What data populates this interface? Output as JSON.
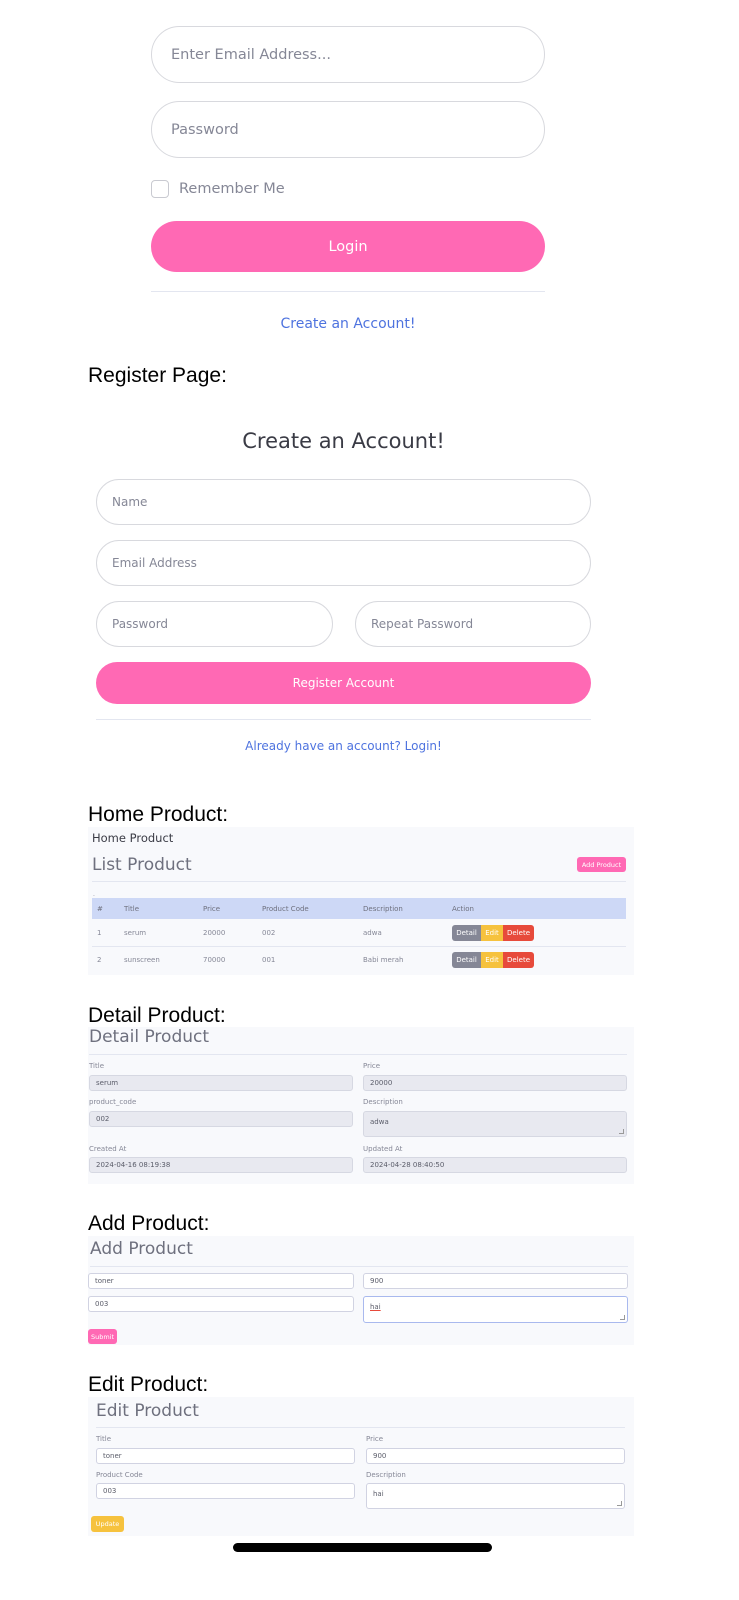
{
  "login": {
    "email_placeholder": "Enter Email Address...",
    "password_placeholder": "Password",
    "remember_label": "Remember Me",
    "login_button": "Login",
    "create_account_link": "Create an Account!"
  },
  "register": {
    "section_label": "Register Page:",
    "heading": "Create an Account!",
    "name_placeholder": "Name",
    "email_placeholder": "Email Address",
    "password_placeholder": "Password",
    "repeat_password_placeholder": "Repeat Password",
    "register_button": "Register Account",
    "login_link": "Already have an account? Login!"
  },
  "home": {
    "section_label": "Home Product:",
    "breadcrumb": "Home Product",
    "title": "List Product",
    "add_button": "Add Product",
    "columns": [
      "#",
      "Title",
      "Price",
      "Product Code",
      "Description",
      "Action"
    ],
    "rows": [
      {
        "no": "1",
        "title": "serum",
        "price": "20000",
        "code": "002",
        "description": "adwa"
      },
      {
        "no": "2",
        "title": "sunscreen",
        "price": "70000",
        "code": "001",
        "description": "Babi merah"
      }
    ],
    "actions": {
      "detail": "Detail",
      "edit": "Edit",
      "delete": "Delete"
    }
  },
  "detail": {
    "section_label": "Detail Product:",
    "title": "Detail Product",
    "labels": {
      "title": "Title",
      "price": "Price",
      "code": "product_code",
      "description": "Description",
      "created": "Created At",
      "updated": "Updated At"
    },
    "values": {
      "title": "serum",
      "price": "20000",
      "code": "002",
      "description": "adwa",
      "created": "2024-04-16 08:19:38",
      "updated": "2024-04-28 08:40:50"
    }
  },
  "add": {
    "section_label": "Add Product:",
    "title": "Add Product",
    "values": {
      "title": "toner",
      "price": "900",
      "code": "003",
      "description": "hai"
    },
    "submit": "Submit"
  },
  "edit": {
    "section_label": "Edit Product:",
    "title": "Edit Product",
    "labels": {
      "title": "Title",
      "price": "Price",
      "code": "Product Code",
      "description": "Description"
    },
    "values": {
      "title": "toner",
      "price": "900",
      "code": "003",
      "description": "hai"
    },
    "update": "Update"
  },
  "colors": {
    "primary_pink": "#ff69b4",
    "link_blue": "#4e73df",
    "edit_yellow": "#f6c23e",
    "delete_red": "#e74a3b",
    "detail_gray": "#858796"
  }
}
